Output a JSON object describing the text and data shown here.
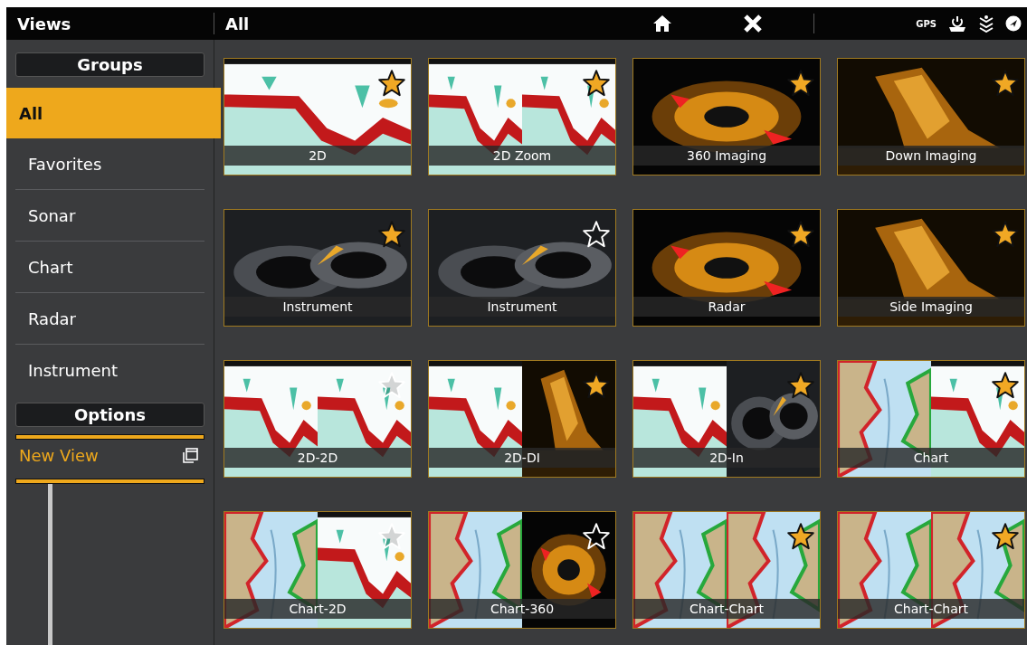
{
  "header": {
    "title": "Views",
    "group": "All",
    "gps": "GPS"
  },
  "sidebar": {
    "groups_button": "Groups",
    "items": [
      {
        "label": "All",
        "selected": true
      },
      {
        "label": "Favorites",
        "selected": false
      },
      {
        "label": "Sonar",
        "selected": false
      },
      {
        "label": "Chart",
        "selected": false
      },
      {
        "label": "Radar",
        "selected": false
      },
      {
        "label": "Instrument",
        "selected": false
      }
    ],
    "options_button": "Options",
    "new_view": "New View"
  },
  "views": [
    {
      "label": "2D",
      "favorite": true,
      "kind": "picture"
    },
    {
      "label": "2D Zoom",
      "favorite": true,
      "kind": "picture"
    },
    {
      "label": "360 Imaging",
      "favorite": true,
      "kind": "picture"
    },
    {
      "label": "Down Imaging",
      "favorite": true,
      "kind": "picture"
    },
    {
      "label": "Instrument",
      "favorite": true,
      "kind": "picture"
    },
    {
      "label": "Instrument",
      "favorite": false,
      "kind": "picture"
    },
    {
      "label": "Radar",
      "favorite": true,
      "kind": "picture"
    },
    {
      "label": "Side Imaging",
      "favorite": true,
      "kind": "picture"
    },
    {
      "label": "2D-2D",
      "favorite": false,
      "kind": "picture"
    },
    {
      "label": "2D-DI",
      "favorite": true,
      "kind": "picture"
    },
    {
      "label": "2D-In",
      "favorite": true,
      "kind": "picture"
    },
    {
      "label": "Chart",
      "favorite": true,
      "kind": "picture"
    },
    {
      "label": "Chart-2D",
      "favorite": false,
      "kind": "picture"
    },
    {
      "label": "Chart-360",
      "favorite": false,
      "kind": "picture"
    },
    {
      "label": "Chart-Chart",
      "favorite": true,
      "kind": "picture"
    },
    {
      "label": "Chart-Chart",
      "favorite": true,
      "kind": "picture"
    }
  ]
}
